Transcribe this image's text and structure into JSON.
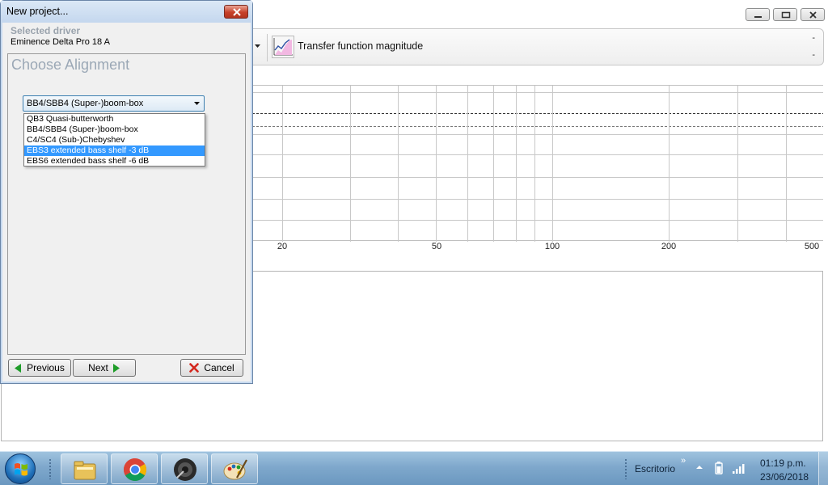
{
  "main": {
    "toolbar": {
      "transfer_function_label": "Transfer function magnitude",
      "dash_top": "-",
      "dash_bottom": "-"
    },
    "graph": {
      "x_tick_labels": [
        {
          "text": "20"
        },
        {
          "text": "50"
        },
        {
          "text": "100"
        },
        {
          "text": "200"
        },
        {
          "text": "500"
        }
      ]
    }
  },
  "dialog": {
    "title": "New project...",
    "selected_driver_heading": "Selected driver",
    "selected_driver_name": "Eminence Delta Pro 18 A",
    "choose_alignment_heading": "Choose Alignment",
    "alignment_combo": {
      "selected_value": "BB4/SBB4 (Super-)boom-box",
      "options": [
        {
          "label": "QB3 Quasi-butterworth",
          "highlighted": false
        },
        {
          "label": "BB4/SBB4 (Super-)boom-box",
          "highlighted": false
        },
        {
          "label": "C4/SC4 (Sub-)Chebyshev",
          "highlighted": false
        },
        {
          "label": "EBS3 extended bass shelf -3 dB",
          "highlighted": true
        },
        {
          "label": "EBS6 extended bass shelf -6 dB",
          "highlighted": false
        }
      ]
    },
    "buttons": {
      "previous": "Previous",
      "next": "Next",
      "cancel": "Cancel"
    }
  },
  "taskbar": {
    "apps": [
      {
        "icon": "file-explorer-icon"
      },
      {
        "icon": "chrome-icon"
      },
      {
        "icon": "speaker-app-icon"
      },
      {
        "icon": "paint-icon"
      }
    ],
    "tray_label": "Escritorio",
    "tray_chevron": "»",
    "time": "01:19 p.m.",
    "date": "23/06/2018"
  },
  "colors": {
    "selection_highlight": "#3399ff",
    "dialog_frame": "#c6d9ef",
    "heading_gray": "#9ba8b6",
    "taskbar": "#7fa8cc"
  }
}
